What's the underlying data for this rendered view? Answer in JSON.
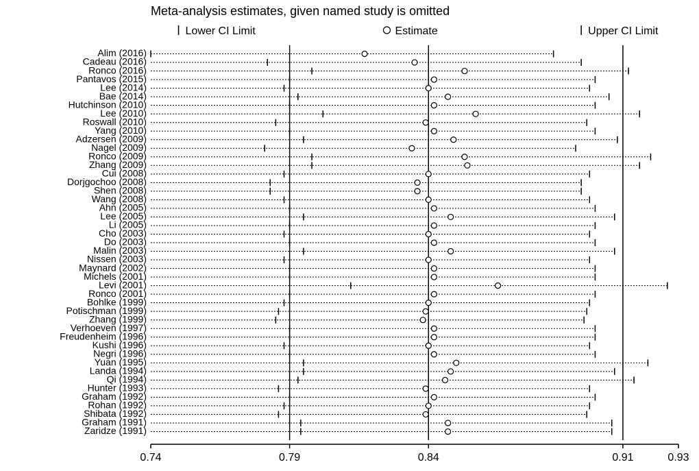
{
  "chart_data": {
    "type": "forest",
    "title": "Meta-analysis estimates, given named study is omitted",
    "legend": {
      "lower": "Lower CI Limit",
      "estimate": "Estimate",
      "upper": "Upper CI Limit"
    },
    "xlim": [
      0.74,
      0.93
    ],
    "xticks": [
      0.74,
      0.79,
      0.84,
      0.91,
      0.93
    ],
    "overall": {
      "lower": 0.79,
      "estimate": 0.84,
      "upper": 0.91
    },
    "rows": [
      {
        "label": "Alim (2016)",
        "lower": 0.74,
        "estimate": 0.817,
        "upper": 0.885
      },
      {
        "label": "Cadeau (2016)",
        "lower": 0.782,
        "estimate": 0.835,
        "upper": 0.895
      },
      {
        "label": "Ronco (2016)",
        "lower": 0.798,
        "estimate": 0.853,
        "upper": 0.912
      },
      {
        "label": "Pantavos (2015)",
        "lower": 0.79,
        "estimate": 0.842,
        "upper": 0.9
      },
      {
        "label": "Lee (2014)",
        "lower": 0.788,
        "estimate": 0.84,
        "upper": 0.898
      },
      {
        "label": "Bae (2014)",
        "lower": 0.793,
        "estimate": 0.847,
        "upper": 0.905
      },
      {
        "label": "Hutchinson (2010)",
        "lower": 0.79,
        "estimate": 0.842,
        "upper": 0.9
      },
      {
        "label": "Lee (2010)",
        "lower": 0.802,
        "estimate": 0.857,
        "upper": 0.916
      },
      {
        "label": "Roswall (2010)",
        "lower": 0.785,
        "estimate": 0.839,
        "upper": 0.897
      },
      {
        "label": "Yang (2010)",
        "lower": 0.79,
        "estimate": 0.842,
        "upper": 0.9
      },
      {
        "label": "Adzersen (2009)",
        "lower": 0.795,
        "estimate": 0.849,
        "upper": 0.908
      },
      {
        "label": "Nagel (2009)",
        "lower": 0.781,
        "estimate": 0.834,
        "upper": 0.893
      },
      {
        "label": "Ronco (2009)",
        "lower": 0.798,
        "estimate": 0.853,
        "upper": 0.92
      },
      {
        "label": "Zhang (2009)",
        "lower": 0.798,
        "estimate": 0.854,
        "upper": 0.916
      },
      {
        "label": "Cui (2008)",
        "lower": 0.788,
        "estimate": 0.84,
        "upper": 0.898
      },
      {
        "label": "Dorjgochoo (2008)",
        "lower": 0.783,
        "estimate": 0.836,
        "upper": 0.895
      },
      {
        "label": "Shen (2008)",
        "lower": 0.783,
        "estimate": 0.836,
        "upper": 0.895
      },
      {
        "label": "Wang (2008)",
        "lower": 0.788,
        "estimate": 0.84,
        "upper": 0.898
      },
      {
        "label": "Ahn (2005)",
        "lower": 0.79,
        "estimate": 0.842,
        "upper": 0.9
      },
      {
        "label": "Lee (2005)",
        "lower": 0.795,
        "estimate": 0.848,
        "upper": 0.907
      },
      {
        "label": "Li (2005)",
        "lower": 0.79,
        "estimate": 0.842,
        "upper": 0.9
      },
      {
        "label": "Cho (2003)",
        "lower": 0.788,
        "estimate": 0.84,
        "upper": 0.898
      },
      {
        "label": "Do (2003)",
        "lower": 0.79,
        "estimate": 0.842,
        "upper": 0.9
      },
      {
        "label": "Malin (2003)",
        "lower": 0.795,
        "estimate": 0.848,
        "upper": 0.907
      },
      {
        "label": "Nissen (2003)",
        "lower": 0.788,
        "estimate": 0.84,
        "upper": 0.898
      },
      {
        "label": "Maynard (2002)",
        "lower": 0.79,
        "estimate": 0.842,
        "upper": 0.9
      },
      {
        "label": "Michels (2001)",
        "lower": 0.79,
        "estimate": 0.842,
        "upper": 0.9
      },
      {
        "label": "Levi (2001)",
        "lower": 0.812,
        "estimate": 0.865,
        "upper": 0.926
      },
      {
        "label": "Ronco (2001)",
        "lower": 0.79,
        "estimate": 0.842,
        "upper": 0.9
      },
      {
        "label": "Bohlke (1999)",
        "lower": 0.788,
        "estimate": 0.84,
        "upper": 0.898
      },
      {
        "label": "Potischman (1999)",
        "lower": 0.786,
        "estimate": 0.839,
        "upper": 0.897
      },
      {
        "label": "Zhang (1999)",
        "lower": 0.785,
        "estimate": 0.838,
        "upper": 0.896
      },
      {
        "label": "Verhoeven (1997)",
        "lower": 0.79,
        "estimate": 0.842,
        "upper": 0.9
      },
      {
        "label": "Freudenheim (1996)",
        "lower": 0.79,
        "estimate": 0.842,
        "upper": 0.9
      },
      {
        "label": "Kushi (1996)",
        "lower": 0.788,
        "estimate": 0.84,
        "upper": 0.898
      },
      {
        "label": "Negri (1996)",
        "lower": 0.79,
        "estimate": 0.842,
        "upper": 0.9
      },
      {
        "label": "Yuan (1995)",
        "lower": 0.795,
        "estimate": 0.85,
        "upper": 0.919
      },
      {
        "label": "Landa (1994)",
        "lower": 0.795,
        "estimate": 0.848,
        "upper": 0.907
      },
      {
        "label": "Qi (1994)",
        "lower": 0.793,
        "estimate": 0.846,
        "upper": 0.914
      },
      {
        "label": "Hunter (1993)",
        "lower": 0.786,
        "estimate": 0.839,
        "upper": 0.898
      },
      {
        "label": "Graham (1992)",
        "lower": 0.79,
        "estimate": 0.842,
        "upper": 0.9
      },
      {
        "label": "Rohan (1992)",
        "lower": 0.788,
        "estimate": 0.84,
        "upper": 0.898
      },
      {
        "label": "Shibata (1992)",
        "lower": 0.786,
        "estimate": 0.839,
        "upper": 0.897
      },
      {
        "label": "Graham (1991)",
        "lower": 0.794,
        "estimate": 0.847,
        "upper": 0.906
      },
      {
        "label": "Zaridze (1991)",
        "lower": 0.794,
        "estimate": 0.847,
        "upper": 0.906
      }
    ]
  }
}
